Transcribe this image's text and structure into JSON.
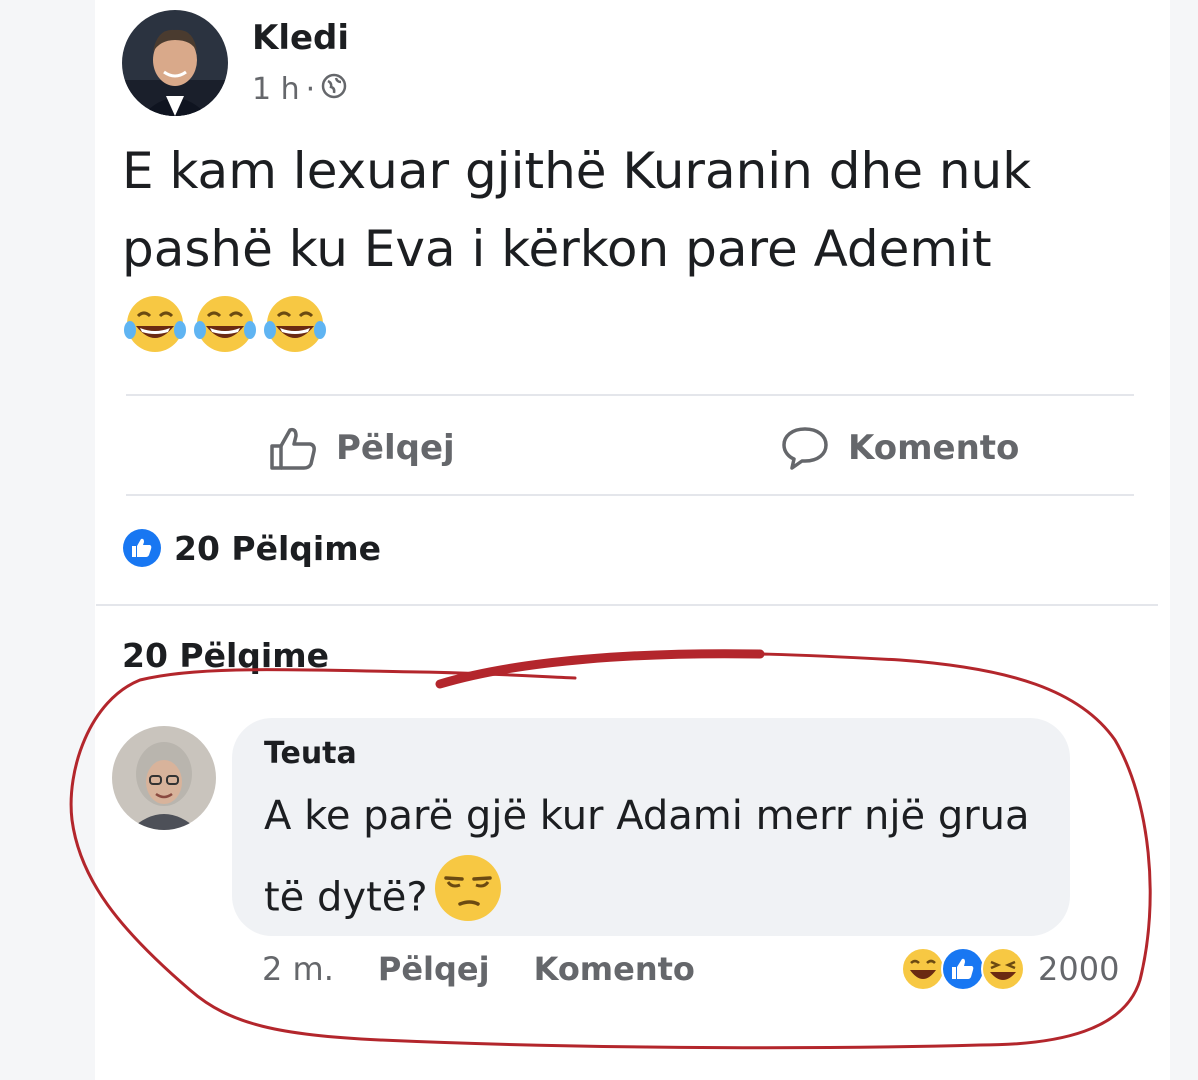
{
  "post": {
    "author": "Kledi",
    "time": "1 h",
    "separator": "·",
    "privacy_icon": "globe-icon",
    "text": "E kam lexuar gjithë Kuranin dhe nuk pashë ku Eva i kërkon pare Ademit",
    "emojis": [
      "laughing-tears-emoji",
      "laughing-tears-emoji",
      "laughing-tears-emoji"
    ]
  },
  "actions": {
    "like_label": "Pëlqej",
    "comment_label": "Komento"
  },
  "likes": {
    "summary": "20 Pëlqime",
    "summary_repeat": "20 Pëlqime"
  },
  "comment": {
    "author": "Teuta",
    "text": "A ke parë gjë kur  Adami merr një grua të dytë?",
    "emoji": "unamused-face-emoji",
    "time": "2 m.",
    "like_label": "Pëlqej",
    "reply_label": "Komento",
    "reaction_count": "2000",
    "reactions": [
      "laughing-tears-emoji",
      "like-icon",
      "laughing-emoji"
    ]
  },
  "colors": {
    "facebook_blue": "#1877f2",
    "annotation_red": "#b3262c",
    "muted_text": "#65676b",
    "bubble_bg": "#f0f2f5"
  }
}
